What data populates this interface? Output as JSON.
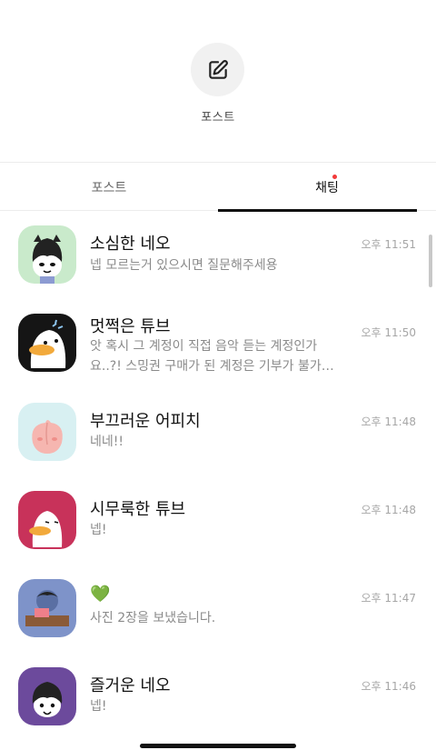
{
  "composer": {
    "label": "포스트",
    "icon": "edit-icon"
  },
  "tabs": [
    {
      "label": "포스트",
      "active": false
    },
    {
      "label": "채팅",
      "active": true,
      "has_badge": true
    }
  ],
  "colors": {
    "badge": "#f23a3a",
    "active_underline": "#111111"
  },
  "chats": [
    {
      "name": "소심한 네오",
      "message": "넵 모르는거 있으시면 질문해주세용",
      "time": "오후 11:51",
      "avatar_bg": "#c9eacb"
    },
    {
      "name": "멋쩍은 튜브",
      "message": "앗 혹시 그 계정이 직접 음악 듣는 계정인가요..?! 스밍권 구매가 된 계정은 기부가 불가…",
      "time": "오후 11:50",
      "avatar_bg": "#151515"
    },
    {
      "name": "부끄러운 어피치",
      "message": "네네!!",
      "time": "오후 11:48",
      "avatar_bg": "#d8f0f2"
    },
    {
      "name": "시무룩한 튜브",
      "message": "넵!",
      "time": "오후 11:48",
      "avatar_bg": "#c8325a"
    },
    {
      "name": "💚",
      "message": "사진 2장을 보냈습니다.",
      "time": "오후 11:47",
      "avatar_bg": "#7e93c9"
    },
    {
      "name": "즐거운 네오",
      "message": "넵!",
      "time": "오후 11:46",
      "avatar_bg": "#6c4a9c"
    }
  ]
}
